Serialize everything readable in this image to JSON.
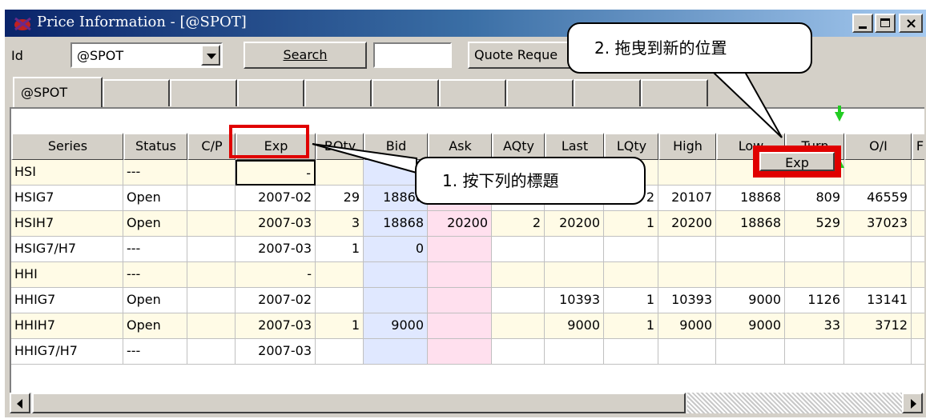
{
  "window": {
    "title": "Price Information - [@SPOT]",
    "controls": [
      "minimize",
      "maximize",
      "close"
    ]
  },
  "toolbar": {
    "id_label": "Id",
    "id_value": "@SPOT",
    "search_label": "Search",
    "quote_label": "Quote Reque"
  },
  "tabs": [
    "@SPOT",
    "",
    "",
    "",
    "",
    "",
    "",
    "",
    "",
    ""
  ],
  "table": {
    "columns": [
      "Series",
      "Status",
      "C/P",
      "Exp",
      "BQty",
      "Bid",
      "Ask",
      "AQty",
      "Last",
      "LQty",
      "High",
      "Low",
      "Turn",
      "O/I",
      "F"
    ],
    "rows": [
      [
        "HSI",
        "---",
        "",
        "-",
        "",
        "",
        "",
        "",
        "",
        "",
        "",
        "",
        "",
        "",
        ""
      ],
      [
        "HSIG7",
        "Open",
        "",
        "2007-02",
        "29",
        "18868",
        "",
        "",
        "",
        "2",
        "20107",
        "18868",
        "809",
        "46559",
        ""
      ],
      [
        "HSIH7",
        "Open",
        "",
        "2007-03",
        "3",
        "18868",
        "20200",
        "2",
        "20200",
        "1",
        "20200",
        "18868",
        "529",
        "37023",
        ""
      ],
      [
        "HSIG7/H7",
        "---",
        "",
        "2007-03",
        "1",
        "0",
        "",
        "",
        "",
        "",
        "",
        "",
        "",
        "",
        ""
      ],
      [
        "HHI",
        "---",
        "",
        "-",
        "",
        "",
        "",
        "",
        "",
        "",
        "",
        "",
        "",
        "",
        ""
      ],
      [
        "HHIG7",
        "Open",
        "",
        "2007-02",
        "",
        "",
        "",
        "",
        "10393",
        "1",
        "10393",
        "9000",
        "1126",
        "13141",
        ""
      ],
      [
        "HHIH7",
        "Open",
        "",
        "2007-03",
        "1",
        "9000",
        "",
        "",
        "9000",
        "1",
        "9000",
        "9000",
        "33",
        "3712",
        ""
      ],
      [
        "HHIG7/H7",
        "---",
        "",
        "2007-03",
        "",
        "",
        "",
        "",
        "",
        "",
        "",
        "",
        "",
        "",
        ""
      ]
    ]
  },
  "callouts": {
    "step1": "1. 按下列的標題",
    "step2": "2. 拖曳到新的位置",
    "drag_label": "Exp"
  },
  "colors": {
    "row_alt": "#fffbe6",
    "bid_col": "#e0e8ff",
    "ask_col": "#ffe0ee",
    "highlight": "#e00000",
    "drop_arrow": "#22cc22"
  },
  "icons": [
    "app-icon",
    "minimize-icon",
    "maximize-icon",
    "close-icon",
    "chevron-down-icon",
    "scroll-left-icon",
    "scroll-right-icon"
  ]
}
